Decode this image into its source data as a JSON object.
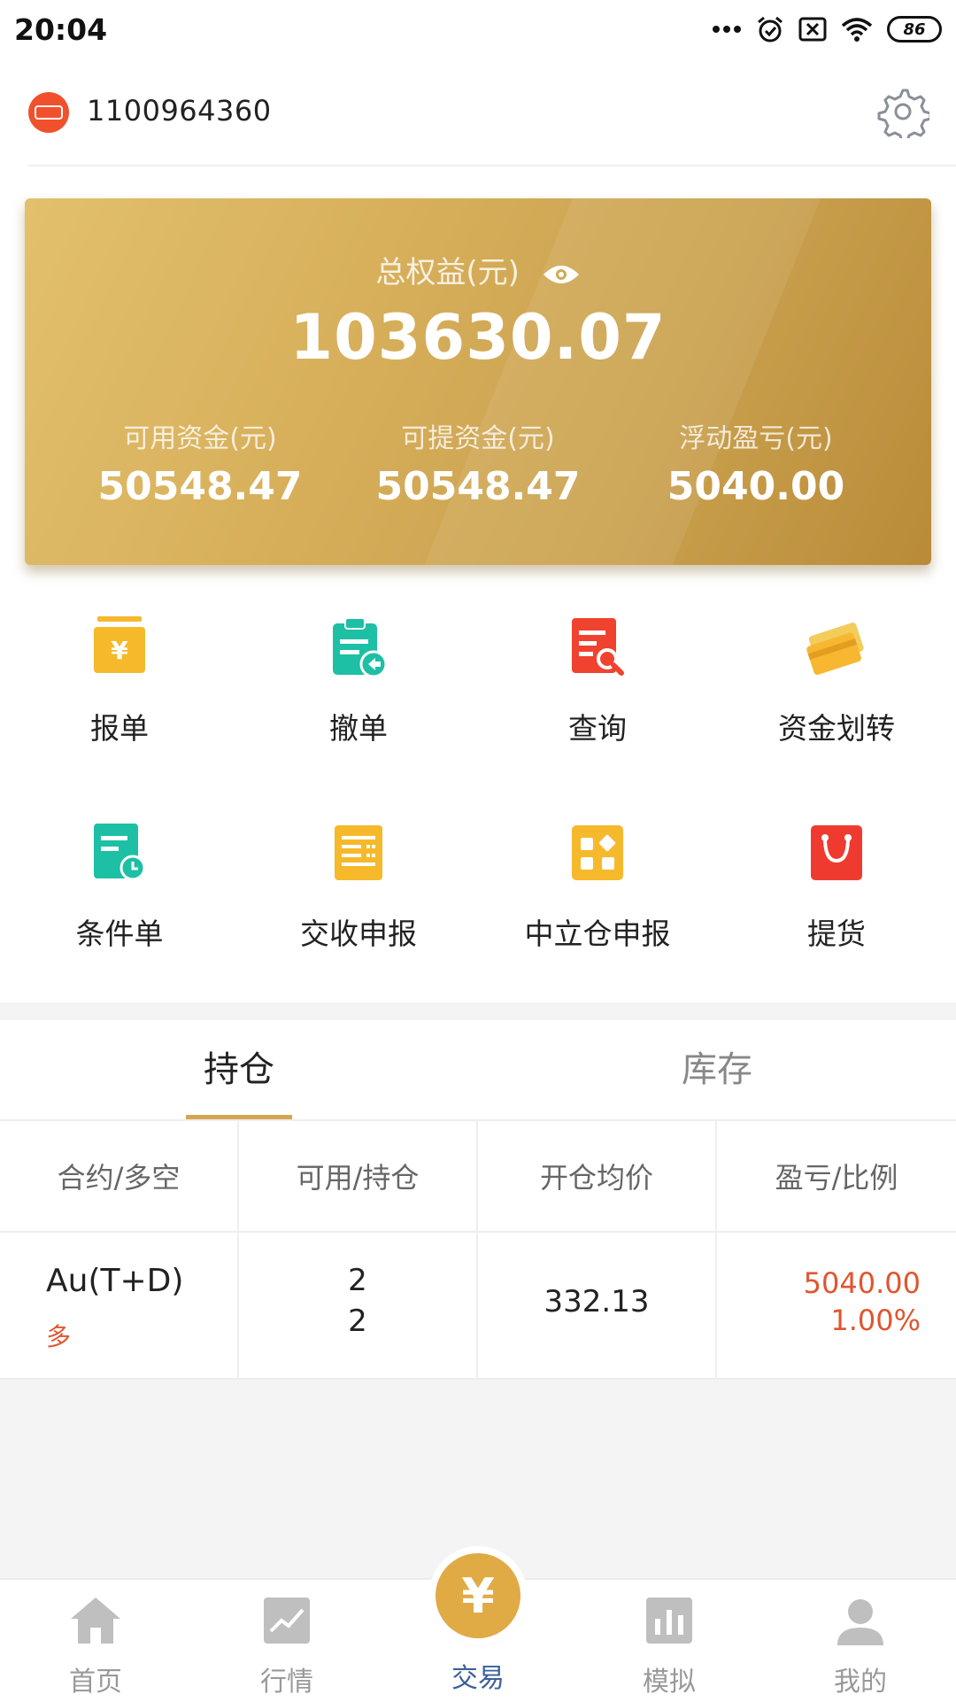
{
  "status_bar": {
    "time": "20:04",
    "battery": "86",
    "icons": [
      "more-dots-icon",
      "alarm-icon",
      "sim-x-icon",
      "wifi-icon",
      "battery-icon"
    ]
  },
  "header": {
    "account_id": "1100964360",
    "logo_icon": "broker-logo-icon",
    "settings_icon": "gear-icon"
  },
  "summary": {
    "total_label": "总权益(元)",
    "total_value": "103630.07",
    "stats": [
      {
        "label": "可用资金(元)",
        "value": "50548.47"
      },
      {
        "label": "可提资金(元)",
        "value": "50548.47"
      },
      {
        "label": "浮动盈亏(元)",
        "value": "5040.00"
      }
    ],
    "card_colors": [
      "#e2c06c",
      "#b98b39"
    ]
  },
  "functions": [
    {
      "label": "报单",
      "icon": "order-yen-icon",
      "color": "#f6b92b"
    },
    {
      "label": "撤单",
      "icon": "cancel-clipboard-icon",
      "color": "#1dbfa5"
    },
    {
      "label": "查询",
      "icon": "query-doc-icon",
      "color": "#ef4330"
    },
    {
      "label": "资金划转",
      "icon": "cards-transfer-icon",
      "color": "#f7b731"
    },
    {
      "label": "条件单",
      "icon": "condition-clock-icon",
      "color": "#1dbfa5"
    },
    {
      "label": "交收申报",
      "icon": "delivery-list-icon",
      "color": "#f6b92b"
    },
    {
      "label": "中立仓申报",
      "icon": "neutral-grid-icon",
      "color": "#f6b92b"
    },
    {
      "label": "提货",
      "icon": "pickup-bag-icon",
      "color": "#ef3b2f"
    }
  ],
  "tabs": [
    {
      "label": "持仓",
      "active": true
    },
    {
      "label": "库存",
      "active": false
    }
  ],
  "table": {
    "headers": [
      "合约/多空",
      "可用/持仓",
      "开仓均价",
      "盈亏/比例"
    ],
    "rows": [
      {
        "contract": "Au(T+D)",
        "direction": "多",
        "available": "2",
        "position": "2",
        "avg_price": "332.13",
        "pnl": "5040.00",
        "ratio": "1.00%"
      }
    ]
  },
  "tabbar": {
    "items": [
      {
        "label": "首页",
        "icon": "home-icon"
      },
      {
        "label": "行情",
        "icon": "trend-chart-icon"
      },
      {
        "label": "交易",
        "icon": "yen-coin-icon",
        "active": true
      },
      {
        "label": "模拟",
        "icon": "bar-chart-icon"
      },
      {
        "label": "我的",
        "icon": "user-icon"
      }
    ],
    "center_symbol": "¥",
    "active_color": "#3c5f98"
  }
}
